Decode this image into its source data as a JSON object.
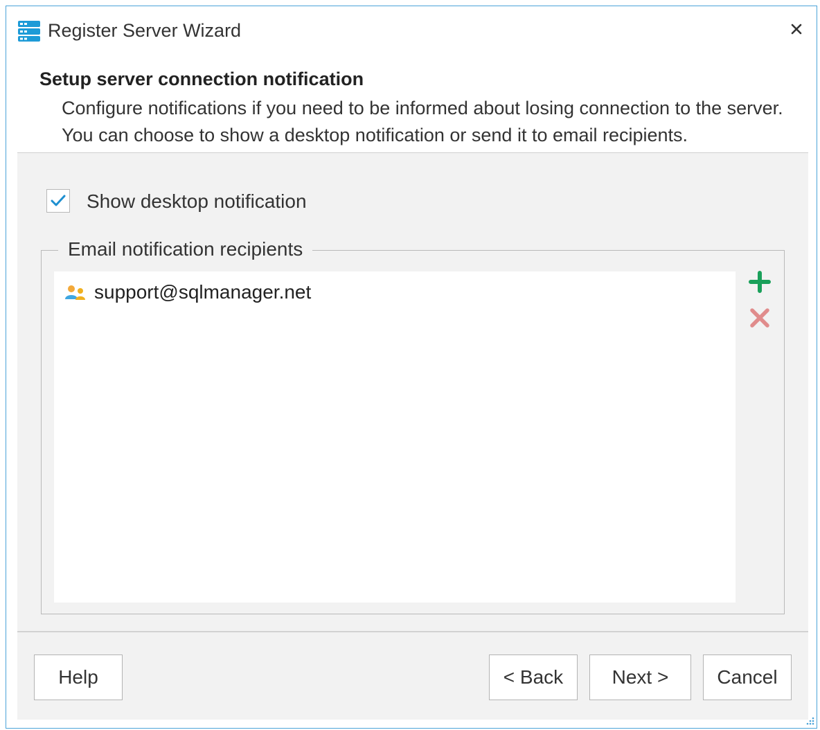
{
  "window": {
    "title": "Register Server Wizard",
    "close_symbol": "✕",
    "accent_color": "#4aa3d8"
  },
  "header": {
    "title": "Setup server connection notification",
    "description": "Configure notifications if you need to be informed about losing connection to the server. You can choose to show a desktop notification or send it to email recipients."
  },
  "desktop_notification": {
    "label": "Show desktop notification",
    "checked": true
  },
  "email_recipients": {
    "legend": "Email notification recipients",
    "items": [
      {
        "icon": "user-group-icon",
        "email": "support@sqlmanager.net"
      }
    ],
    "add_icon": "plus-icon",
    "add_color": "#1aa05a",
    "remove_icon": "close-icon",
    "remove_color": "#e08c8c"
  },
  "footer": {
    "help_label": "Help",
    "back_label": "< Back",
    "next_label": "Next >",
    "cancel_label": "Cancel"
  }
}
